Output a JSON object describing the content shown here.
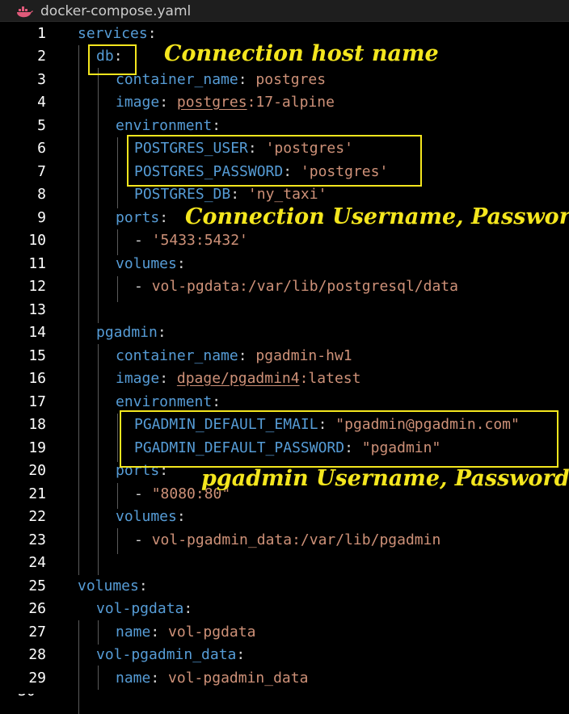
{
  "tab": {
    "title": "docker-compose.yaml",
    "icon": "docker-whale-icon"
  },
  "colors": {
    "key": "#569cd6",
    "string": "#ce9178",
    "punct": "#d4d4d4",
    "line_number": "#ffffff",
    "highlight": "#f4e61e"
  },
  "lines": [
    {
      "n": "1",
      "key": "services",
      "colon": ":",
      "dash": "",
      "value": "",
      "value2": ""
    },
    {
      "n": "2",
      "key": "db",
      "colon": ":",
      "dash": "",
      "value": "",
      "value2": ""
    },
    {
      "n": "3",
      "key": "container_name",
      "colon": ": ",
      "dash": "",
      "value": "postgres",
      "value2": ""
    },
    {
      "n": "4",
      "key": "image",
      "colon": ": ",
      "dash": "",
      "value": "postgres",
      "value2": ":17-alpine"
    },
    {
      "n": "5",
      "key": "environment",
      "colon": ":",
      "dash": "",
      "value": "",
      "value2": ""
    },
    {
      "n": "6",
      "key": "POSTGRES_USER",
      "colon": ": ",
      "dash": "",
      "value": "'postgres'",
      "value2": ""
    },
    {
      "n": "7",
      "key": "POSTGRES_PASSWORD",
      "colon": ": ",
      "dash": "",
      "value": "'postgres'",
      "value2": ""
    },
    {
      "n": "8",
      "key": "POSTGRES_DB",
      "colon": ": ",
      "dash": "",
      "value": "'ny_taxi'",
      "value2": ""
    },
    {
      "n": "9",
      "key": "ports",
      "colon": ":",
      "dash": "",
      "value": "",
      "value2": ""
    },
    {
      "n": "10",
      "key": "",
      "colon": "",
      "dash": "- ",
      "value": "'5433:5432'",
      "value2": ""
    },
    {
      "n": "11",
      "key": "volumes",
      "colon": ":",
      "dash": "",
      "value": "",
      "value2": ""
    },
    {
      "n": "12",
      "key": "",
      "colon": "",
      "dash": "- ",
      "value": "vol-pgdata:/var/lib/postgresql/data",
      "value2": ""
    },
    {
      "n": "13",
      "key": "",
      "colon": "",
      "dash": "",
      "value": "",
      "value2": ""
    },
    {
      "n": "14",
      "key": "pgadmin",
      "colon": ":",
      "dash": "",
      "value": "",
      "value2": ""
    },
    {
      "n": "15",
      "key": "container_name",
      "colon": ": ",
      "dash": "",
      "value": "pgadmin-hw1",
      "value2": ""
    },
    {
      "n": "16",
      "key": "image",
      "colon": ": ",
      "dash": "",
      "value": "dpage/pgadmin4",
      "value2": ":latest"
    },
    {
      "n": "17",
      "key": "environment",
      "colon": ":",
      "dash": "",
      "value": "",
      "value2": ""
    },
    {
      "n": "18",
      "key": "PGADMIN_DEFAULT_EMAIL",
      "colon": ": ",
      "dash": "",
      "value": "\"pgadmin@pgadmin.com\"",
      "value2": ""
    },
    {
      "n": "19",
      "key": "PGADMIN_DEFAULT_PASSWORD",
      "colon": ": ",
      "dash": "",
      "value": "\"pgadmin\"",
      "value2": ""
    },
    {
      "n": "20",
      "key": "ports",
      "colon": ":",
      "dash": "",
      "value": "",
      "value2": ""
    },
    {
      "n": "21",
      "key": "",
      "colon": "",
      "dash": "- ",
      "value": "\"8080:80\"",
      "value2": ""
    },
    {
      "n": "22",
      "key": "volumes",
      "colon": ":",
      "dash": "",
      "value": "",
      "value2": ""
    },
    {
      "n": "23",
      "key": "",
      "colon": "",
      "dash": "- ",
      "value": "vol-pgadmin_data:/var/lib/pgadmin",
      "value2": ""
    },
    {
      "n": "24",
      "key": "",
      "colon": "",
      "dash": "",
      "value": "",
      "value2": ""
    },
    {
      "n": "25",
      "key": "volumes",
      "colon": ":",
      "dash": "",
      "value": "",
      "value2": ""
    },
    {
      "n": "26",
      "key": "vol-pgdata",
      "colon": ":",
      "dash": "",
      "value": "",
      "value2": ""
    },
    {
      "n": "27",
      "key": "name",
      "colon": ": ",
      "dash": "",
      "value": "vol-pgdata",
      "value2": ""
    },
    {
      "n": "28",
      "key": "vol-pgadmin_data",
      "colon": ":",
      "dash": "",
      "value": "",
      "value2": ""
    },
    {
      "n": "29",
      "key": "name",
      "colon": ": ",
      "dash": "",
      "value": "vol-pgadmin_data",
      "value2": ""
    }
  ],
  "annotations": {
    "host": "Connection host name",
    "credentials": "Connection Username, Password",
    "pgadmin": "pgadmin Username, Password"
  }
}
